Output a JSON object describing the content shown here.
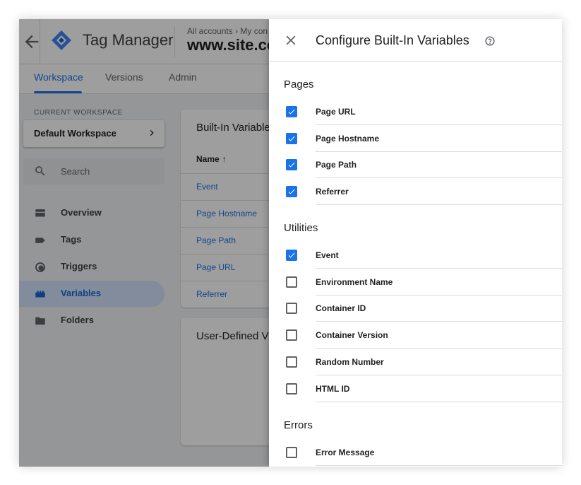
{
  "colors": {
    "accent": "#1a73e8",
    "overlay": "rgba(0,0,0,0.38)"
  },
  "app": {
    "product_name": "Tag Manager",
    "breadcrumb": "All accounts › My con",
    "container_name": "www.site.co",
    "tabs": [
      {
        "label": "Workspace",
        "active": true
      },
      {
        "label": "Versions",
        "active": false
      },
      {
        "label": "Admin",
        "active": false
      }
    ],
    "sidebar": {
      "current_workspace_label": "CURRENT WORKSPACE",
      "workspace_name": "Default Workspace",
      "search_placeholder": "Search",
      "items": [
        {
          "label": "Overview",
          "icon": "overview-icon",
          "active": false
        },
        {
          "label": "Tags",
          "icon": "tag-icon",
          "active": false
        },
        {
          "label": "Triggers",
          "icon": "trigger-icon",
          "active": false
        },
        {
          "label": "Variables",
          "icon": "variables-icon",
          "active": true
        },
        {
          "label": "Folders",
          "icon": "folder-icon",
          "active": false
        }
      ]
    },
    "builtin_card": {
      "title": "Built-In Variable",
      "name_header": "Name",
      "sort_arrow": "↑",
      "rows": [
        "Event",
        "Page Hostname",
        "Page Path",
        "Page URL",
        "Referrer"
      ]
    },
    "user_defined_card": {
      "title": "User-Defined V"
    }
  },
  "drawer": {
    "title": "Configure Built-In Variables",
    "sections": [
      {
        "title": "Pages",
        "items": [
          {
            "label": "Page URL",
            "checked": true
          },
          {
            "label": "Page Hostname",
            "checked": true
          },
          {
            "label": "Page Path",
            "checked": true
          },
          {
            "label": "Referrer",
            "checked": true
          }
        ]
      },
      {
        "title": "Utilities",
        "items": [
          {
            "label": "Event",
            "checked": true
          },
          {
            "label": "Environment Name",
            "checked": false
          },
          {
            "label": "Container ID",
            "checked": false
          },
          {
            "label": "Container Version",
            "checked": false
          },
          {
            "label": "Random Number",
            "checked": false
          },
          {
            "label": "HTML ID",
            "checked": false
          }
        ]
      },
      {
        "title": "Errors",
        "items": [
          {
            "label": "Error Message",
            "checked": false
          }
        ]
      }
    ]
  }
}
